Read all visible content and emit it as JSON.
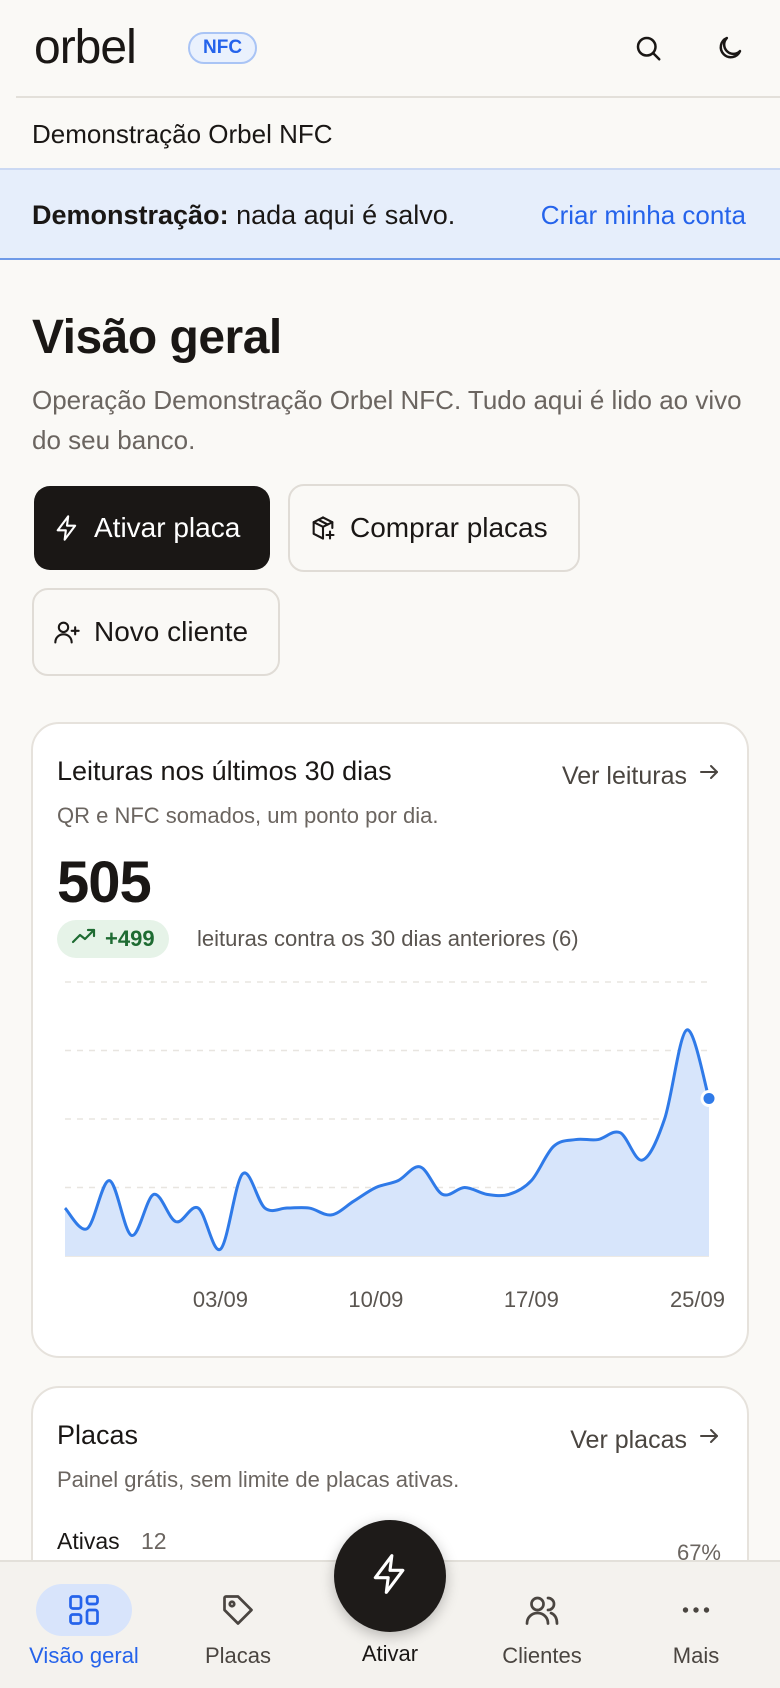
{
  "header": {
    "logo": "orbel",
    "badge": "NFC",
    "icons": [
      "search-icon",
      "moon-icon"
    ],
    "org_name": "Demonstração Orbel NFC"
  },
  "banner": {
    "bold": "Demonstração:",
    "text": " nada aqui é salvo.",
    "link": "Criar minha conta"
  },
  "page": {
    "title": "Visão geral",
    "subtitle": "Operação Demonstração Orbel NFC. Tudo aqui é lido ao vivo do seu banco."
  },
  "actions": {
    "activate": "Ativar placa",
    "buy": "Comprar placas",
    "new_client": "Novo cliente"
  },
  "readings_card": {
    "title": "Leituras nos últimos 30 dias",
    "subtitle": "QR e NFC somados, um ponto por dia.",
    "link": "Ver leituras",
    "total": "505",
    "delta": "+499",
    "delta_note": "leituras contra os 30 dias anteriores (6)"
  },
  "chart_data": {
    "type": "area",
    "title": "Leituras nos últimos 30 dias",
    "xlabel": "",
    "ylabel": "",
    "x": [
      "27/08",
      "28/08",
      "29/08",
      "30/08",
      "31/08",
      "01/09",
      "02/09",
      "03/09",
      "04/09",
      "05/09",
      "06/09",
      "07/09",
      "08/09",
      "09/09",
      "10/09",
      "11/09",
      "12/09",
      "13/09",
      "14/09",
      "15/09",
      "16/09",
      "17/09",
      "18/09",
      "19/09",
      "20/09",
      "21/09",
      "22/09",
      "23/09",
      "24/09",
      "25/09"
    ],
    "values": [
      7,
      4,
      11,
      3,
      9,
      5,
      7,
      1,
      12,
      7,
      7,
      7,
      6,
      8,
      10,
      11,
      13,
      9,
      10,
      9,
      9,
      11,
      16,
      17,
      17,
      18,
      14,
      20,
      33,
      23
    ],
    "x_ticks": [
      "03/09",
      "10/09",
      "17/09",
      "25/09"
    ],
    "ylim": [
      0,
      40
    ],
    "grid": true,
    "color": "#2f7ae8",
    "fill": "#d7e5fb"
  },
  "plates_card": {
    "title": "Placas",
    "subtitle": "Painel grátis, sem limite de placas ativas.",
    "link": "Ver placas",
    "active_label": "Ativas",
    "active_value": "12",
    "percent": "67%"
  },
  "nav": {
    "items": [
      {
        "label": "Visão geral",
        "icon": "grid-icon",
        "active": true
      },
      {
        "label": "Placas",
        "icon": "tag-icon",
        "active": false
      },
      {
        "label": "Ativar",
        "icon": "zap-icon",
        "active": false
      },
      {
        "label": "Clientes",
        "icon": "users-icon",
        "active": false
      },
      {
        "label": "Mais",
        "icon": "more-icon",
        "active": false
      }
    ]
  },
  "colors": {
    "accent": "#2563eb",
    "dark": "#1a1715",
    "banner_bg": "#e6eefb",
    "success": "#1e6b32"
  }
}
